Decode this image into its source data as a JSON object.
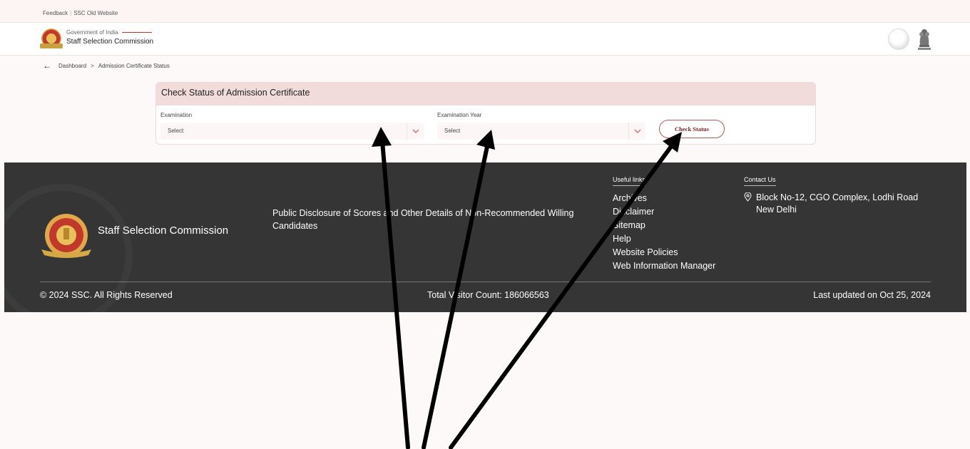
{
  "topbar": {
    "feedback": "Feedback",
    "separator": "|",
    "old_site": "SSC Old Website"
  },
  "header": {
    "gov_text": "Government of India",
    "org_name": "Staff Selection Commission",
    "icons": {
      "logo": "ssc-logo-icon",
      "theme": "theme-toggle-icon",
      "emblem": "national-emblem-icon"
    }
  },
  "breadcrumb": {
    "back_icon": "arrow-left-icon",
    "home": "Dashboard",
    "separator": ">",
    "current": "Admission Certificate Status"
  },
  "card": {
    "title": "Check Status of Admission Certificate",
    "exam_label": "Examination",
    "exam_value": "Select",
    "year_label": "Examination Year",
    "year_value": "Select",
    "button": "Check Status"
  },
  "footer": {
    "brand": "Staff Selection Commission",
    "disclosure": "Public Disclosure of Scores and Other Details of Non-Recommended Willing Candidates",
    "useful_links_title": "Useful links",
    "useful_links": [
      "Archives",
      "Disclaimer",
      "Sitemap",
      "Help",
      "Website Policies",
      "Web Information Manager"
    ],
    "contact_title": "Contact Us",
    "address_line1": "Block No-12, CGO Complex, Lodhi Road",
    "address_line2": "New Delhi",
    "copyright": "© 2024 SSC. All Rights Reserved",
    "visitor_count": "Total Visitor Count: 186066563",
    "last_updated": "Last updated on Oct 25, 2024"
  },
  "colors": {
    "accent": "#b65b5b",
    "card_header": "#f2dcdb",
    "footer_bg": "#353535",
    "page_bg": "#fdf9f8"
  }
}
